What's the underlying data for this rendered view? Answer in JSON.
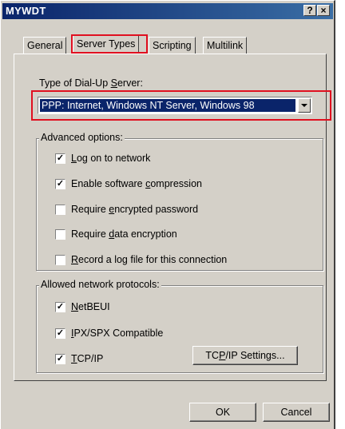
{
  "window": {
    "title": "MYWDT",
    "help_btn": "?",
    "close_btn": "×"
  },
  "tabs": [
    {
      "label": "General"
    },
    {
      "label": "Server Types",
      "active": true
    },
    {
      "label": "Scripting"
    },
    {
      "label": "Multilink"
    }
  ],
  "server": {
    "label_pre": "Type of Dial-Up ",
    "label_u": "S",
    "label_post": "erver:",
    "selected": "PPP: Internet, Windows NT Server, Windows 98"
  },
  "advanced": {
    "title": "Advanced options:",
    "items": [
      {
        "pre": "",
        "u": "L",
        "post": "og on to network",
        "checked": true,
        "mark": "✓"
      },
      {
        "pre": "Enable software ",
        "u": "c",
        "post": "ompression",
        "checked": true,
        "mark": "✓"
      },
      {
        "pre": "Require ",
        "u": "e",
        "post": "ncrypted password",
        "checked": false,
        "mark": ""
      },
      {
        "pre": "Require ",
        "u": "d",
        "post": "ata encryption",
        "checked": false,
        "mark": ""
      },
      {
        "pre": "",
        "u": "R",
        "post": "ecord a log file for this connection",
        "checked": false,
        "mark": ""
      }
    ]
  },
  "protocols": {
    "title": "Allowed network protocols:",
    "items": [
      {
        "pre": "",
        "u": "N",
        "post": "etBEUI",
        "checked": true,
        "mark": "✓"
      },
      {
        "pre": "",
        "u": "I",
        "post": "PX/SPX Compatible",
        "checked": true,
        "mark": "✓"
      },
      {
        "pre": "",
        "u": "T",
        "post": "CP/IP",
        "checked": true,
        "mark": "✓"
      }
    ],
    "tcpip_btn_pre": "TC",
    "tcpip_btn_u": "P",
    "tcpip_btn_post": "/IP Settings..."
  },
  "buttons": {
    "ok": "OK",
    "cancel": "Cancel"
  },
  "colors": {
    "highlight": "#e01020",
    "titlebar": "#0a246a",
    "selection": "#0a246a"
  }
}
